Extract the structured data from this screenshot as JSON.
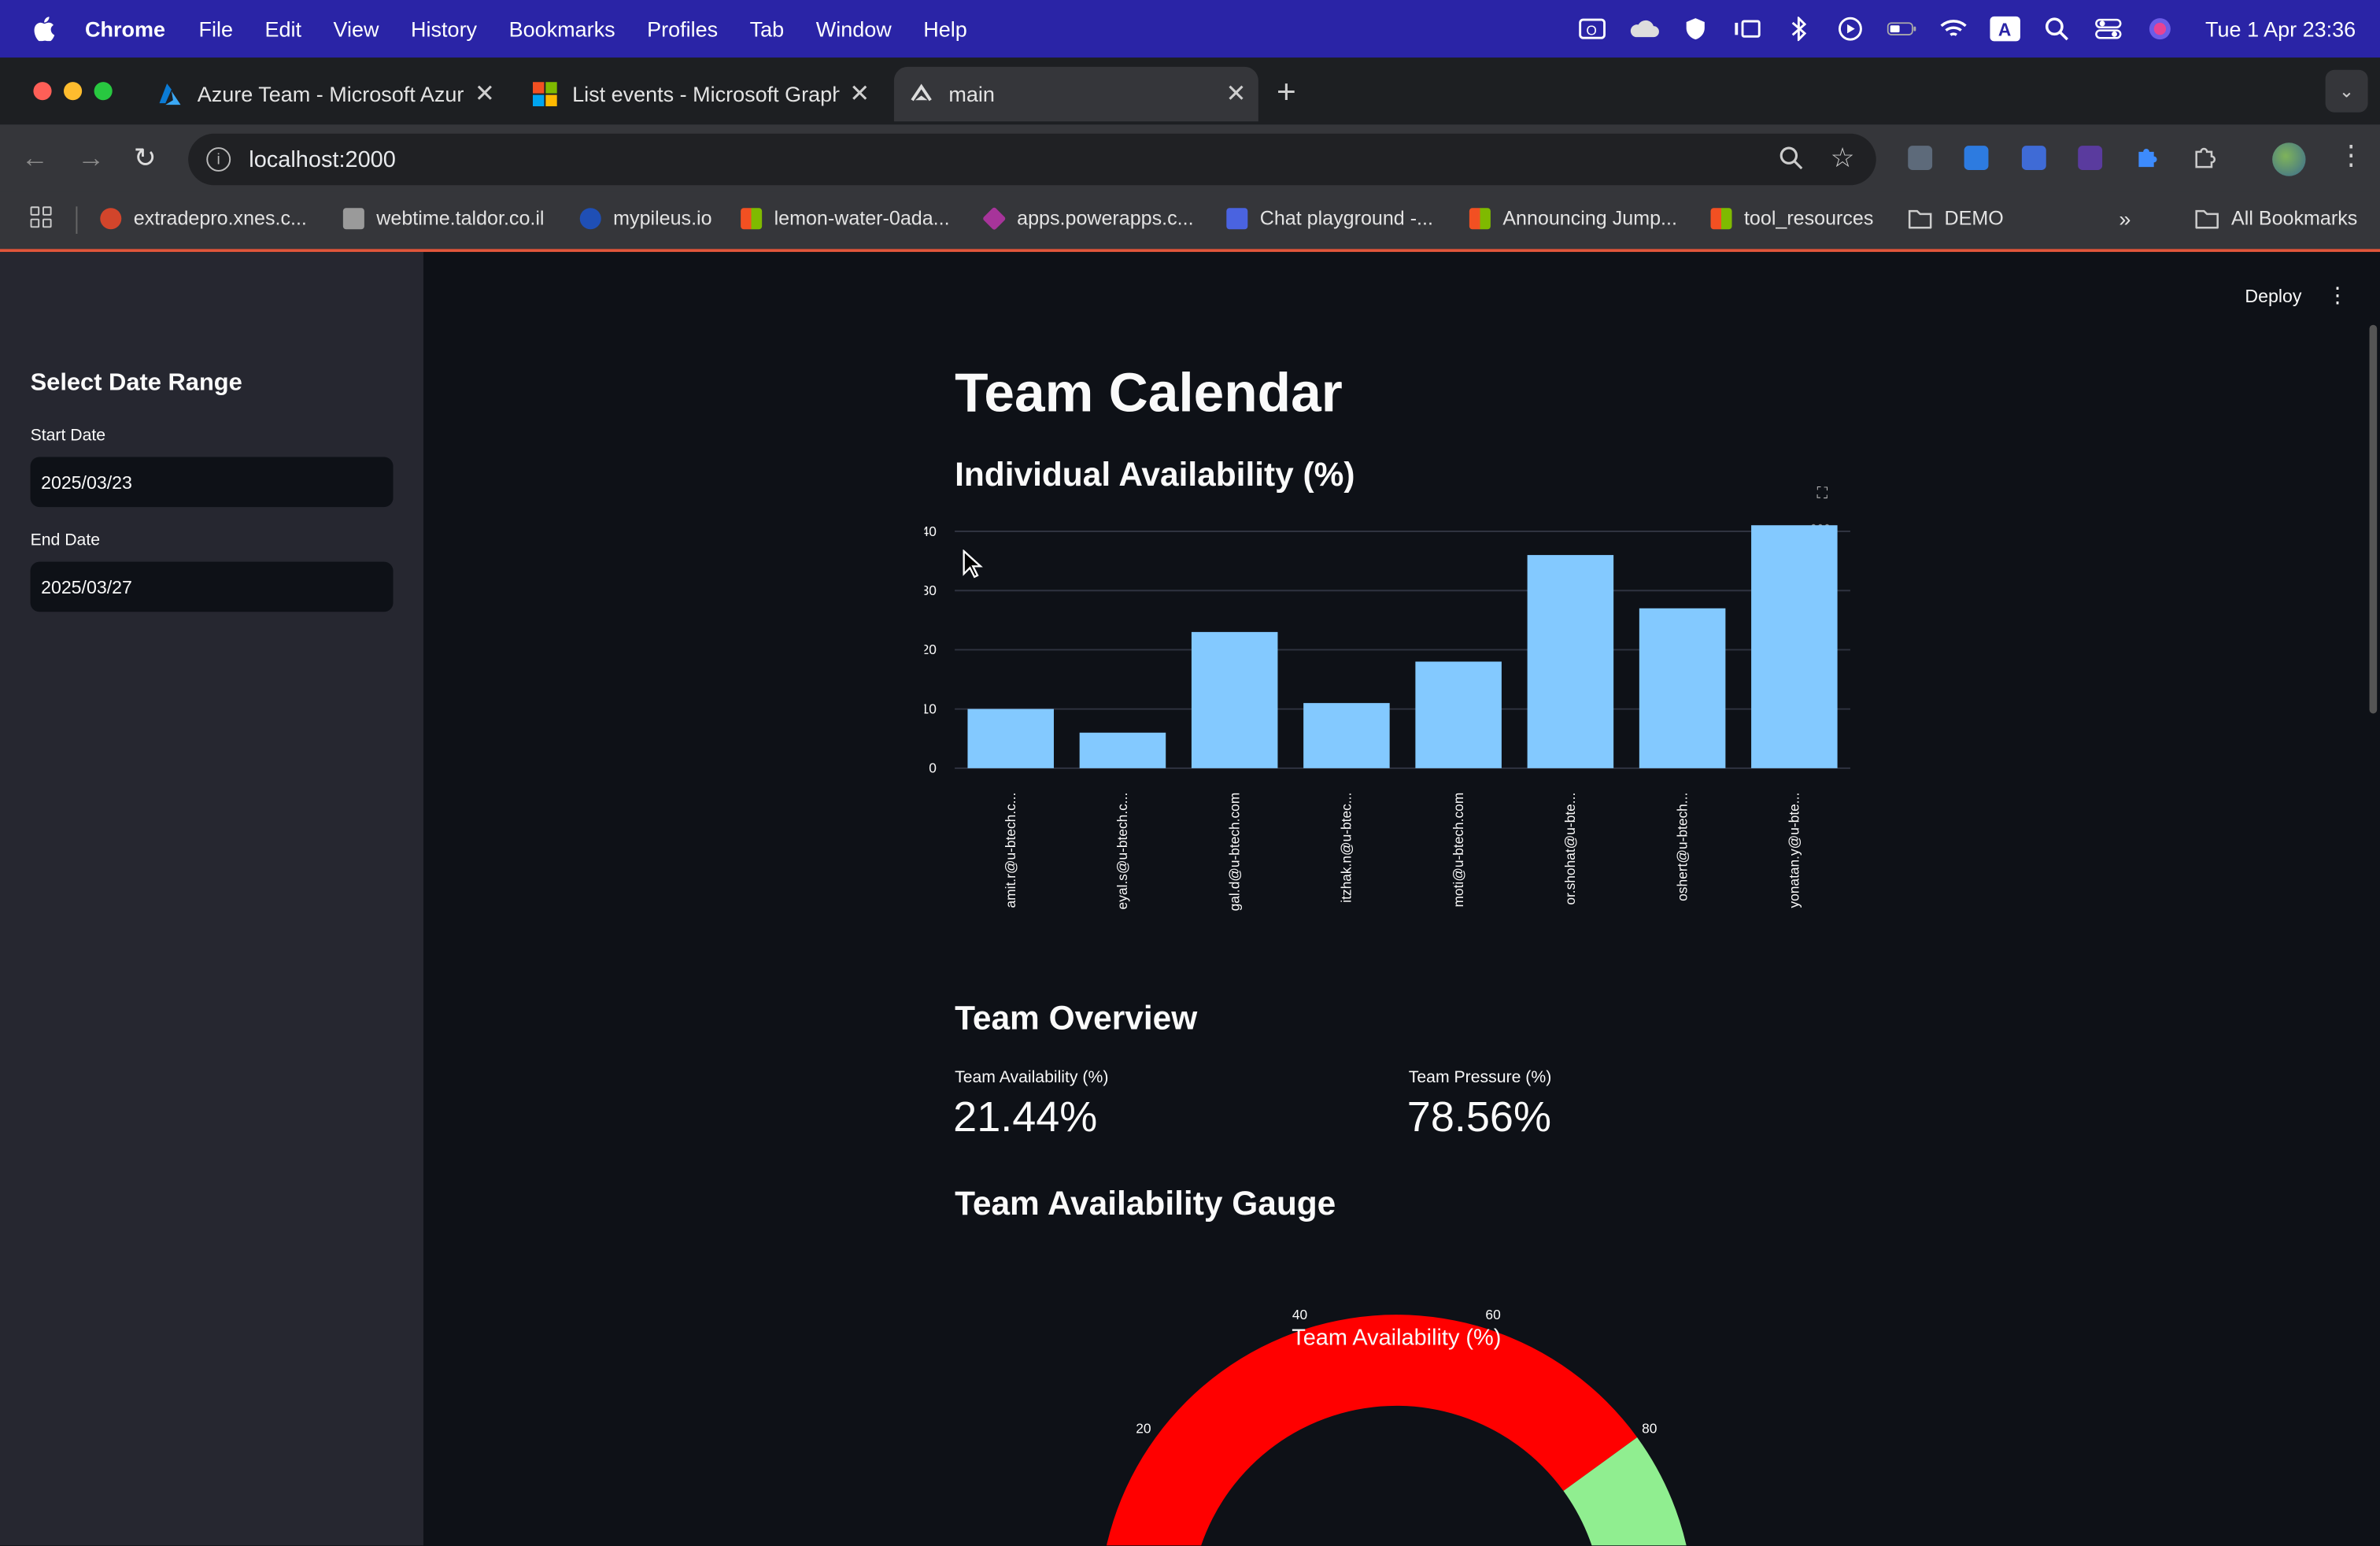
{
  "menubar": {
    "app": "Chrome",
    "items": [
      "File",
      "Edit",
      "View",
      "History",
      "Bookmarks",
      "Profiles",
      "Tab",
      "Window",
      "Help"
    ],
    "clock": "Tue 1 Apr  23:36"
  },
  "tabs": [
    {
      "title": "Azure Team - Microsoft Azure",
      "icon": "azure-icon"
    },
    {
      "title": "List events - Microsoft Graph",
      "icon": "microsoft-icon"
    },
    {
      "title": "main",
      "icon": "streamlit-icon"
    }
  ],
  "toolbar": {
    "url": "localhost:2000"
  },
  "bookmarks": [
    {
      "label": "extradepro.xnes.c...",
      "color": "#d2452b"
    },
    {
      "label": "webtime.taldor.co.il",
      "color": "#9a9a9a"
    },
    {
      "label": "mypileus.io",
      "color": "#1f4fb5"
    },
    {
      "label": "lemon-water-0ada...",
      "color": "#f25022"
    },
    {
      "label": "apps.powerapps.c...",
      "color": "#a7349a"
    },
    {
      "label": "Chat playground -...",
      "color": "#4a63e0"
    },
    {
      "label": "Announcing Jump...",
      "color": "#f25022"
    },
    {
      "label": "tool_resources",
      "color": "#f25022"
    },
    {
      "label": "DEMO",
      "color": "folder"
    }
  ],
  "bookmarks_all": "All Bookmarks",
  "sidebar": {
    "title": "Select Date Range",
    "start_label": "Start Date",
    "start_value": "2025/03/23",
    "end_label": "End Date",
    "end_value": "2025/03/27"
  },
  "main": {
    "deploy": "Deploy",
    "title": "Team Calendar",
    "chart_heading": "Individual Availability (%)",
    "overview_heading": "Team Overview",
    "gauge_heading": "Team Availability Gauge",
    "metrics": [
      {
        "label": "Team Availability (%)",
        "value": "21.44%"
      },
      {
        "label": "Team Pressure (%)",
        "value": "78.56%"
      }
    ]
  },
  "chart_data": [
    {
      "type": "bar",
      "categories": [
        "amit.r@u-btech.c...",
        "eyal.s@u-btech.c...",
        "gal.d@u-btech.com",
        "itzhak.n@u-btec...",
        "moti@u-btech.com",
        "or.shohat@u-bte...",
        "oshert@u-btech...",
        "yonatan.y@u-bte..."
      ],
      "values": [
        10,
        6,
        23,
        11,
        18,
        36,
        27,
        42
      ],
      "yticks": [
        0,
        10,
        20,
        30,
        40
      ],
      "ylim": [
        0,
        40
      ],
      "title": "",
      "xlabel": "",
      "ylabel": "",
      "bar_color": "#83c9ff",
      "grid": true
    },
    {
      "type": "gauge",
      "title": "Team Availability (%)",
      "value": 21.44,
      "range": [
        0,
        100
      ],
      "tick_labels": [
        "20",
        "40",
        "60",
        "80"
      ],
      "bands": [
        {
          "from": 0,
          "to": 80,
          "color": "#ff0000"
        },
        {
          "from": 80,
          "to": 100,
          "color": "#90ee90"
        }
      ]
    }
  ]
}
